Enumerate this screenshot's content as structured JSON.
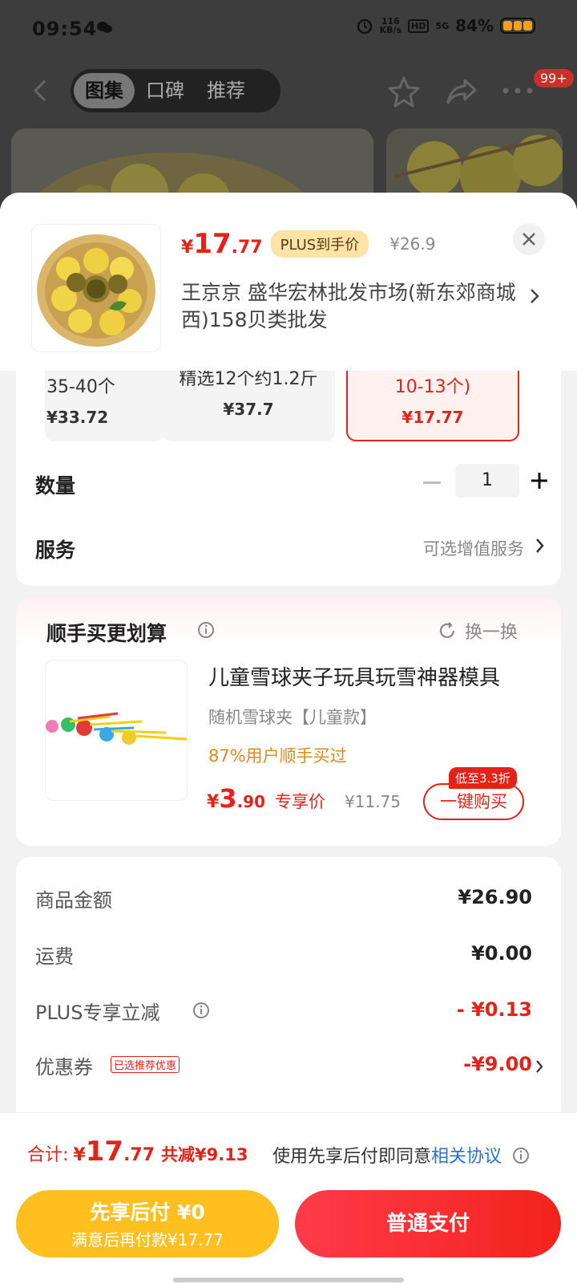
{
  "status_bar": {
    "time": "09:54",
    "speed_top": "116",
    "speed_bottom": "KB/s",
    "hd": "HD",
    "net": "5G",
    "battery": "84%"
  },
  "nav": {
    "tabs": [
      {
        "label": "图集",
        "active": true
      },
      {
        "label": "口碑"
      },
      {
        "label": "推荐"
      }
    ],
    "badge": "99+"
  },
  "product": {
    "currency": "¥",
    "price_int": "17",
    "price_dec": ".77",
    "plus_tag": "PLUS到手价",
    "original_price": "¥26.9",
    "store": "王京京  盛华宏林批发市场(新东郊商城西)158贝类批发"
  },
  "options": [
    {
      "line1": "35-40个",
      "price": "¥33.72"
    },
    {
      "line1": "精选12个约1.2斤",
      "price": "¥37.7"
    },
    {
      "line1": "10-13个)",
      "price": "¥17.77",
      "selected": true
    }
  ],
  "quantity": {
    "label": "数量",
    "value": "1"
  },
  "service": {
    "label": "服务",
    "value": "可选增值服务"
  },
  "recommend": {
    "title": "顺手买更划算",
    "swap_label": "换一换",
    "item_name": "儿童雪球夹子玩具玩雪神器模具",
    "spec": "随机雪球夹【儿童款】",
    "buyers": "87%用户顺手买过",
    "price_int": "3",
    "price_dec": ".90",
    "price_tag": "专享价",
    "original_price": "¥11.75",
    "discount_badge": "低至3.3折",
    "buy_label": "一键购买"
  },
  "summary": {
    "rows": [
      {
        "label": "商品金额",
        "value": "¥26.90"
      },
      {
        "label": "运费",
        "value": "¥0.00"
      },
      {
        "label": "PLUS专享立减",
        "value": "- ¥0.13"
      },
      {
        "label": "优惠券",
        "value": "-¥9.00",
        "tag": "已选推荐优惠"
      }
    ]
  },
  "footer": {
    "total_label": "合计:",
    "total_currency": "¥",
    "total_int": "17",
    "total_dec": ".77",
    "total_saved": "共减¥9.13",
    "agree_text": "使用先享后付即同意",
    "agree_link": "相关协议",
    "pay_later_title": "先享后付 ¥0",
    "pay_later_sub": "满意后再付款¥17.77",
    "pay_normal": "普通支付"
  },
  "colors": {
    "accent": "#e2231a",
    "plus_tag_bg": "#fde3a6",
    "pay_later": "#ffbf1f",
    "link": "#2a6fd6"
  }
}
